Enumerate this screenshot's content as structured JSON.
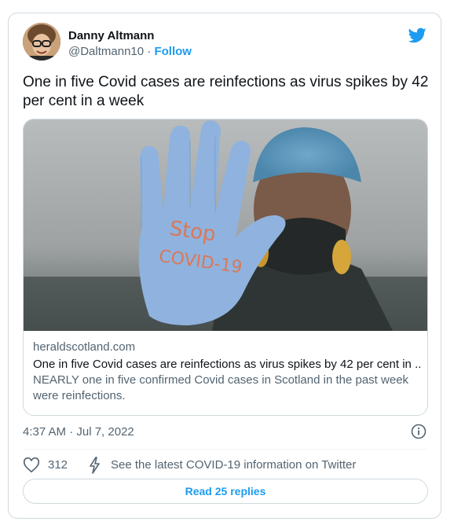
{
  "tweet": {
    "author_name": "Danny Altmann",
    "handle": "@Daltmann10",
    "separator": "·",
    "follow_label": "Follow",
    "text": "One in five Covid cases are reinfections as virus spikes by 42 per cent in a week",
    "timestamp": "4:37 AM · Jul 7, 2022",
    "like_count": "312",
    "covid_info_text": "See the latest COVID-19 information on Twitter",
    "read_replies_label": "Read 25 replies"
  },
  "link_card": {
    "domain": "heraldscotland.com",
    "title": "One in five Covid cases are reinfections as virus spikes by 42 per cent in ...",
    "description": "NEARLY one in five confirmed Covid cases in Scotland in the past week were reinfections.",
    "image_text_line1": "Stop",
    "image_text_line2": "COVID-19"
  },
  "colors": {
    "accent": "#1d9bf0",
    "secondary_text": "#536471",
    "border": "#cfd9de",
    "glove": "#8fb3de",
    "glove_text": "#d9785a"
  },
  "icons": [
    "twitter-bird-icon",
    "info-icon",
    "heart-icon",
    "lightning-bolt-icon"
  ]
}
